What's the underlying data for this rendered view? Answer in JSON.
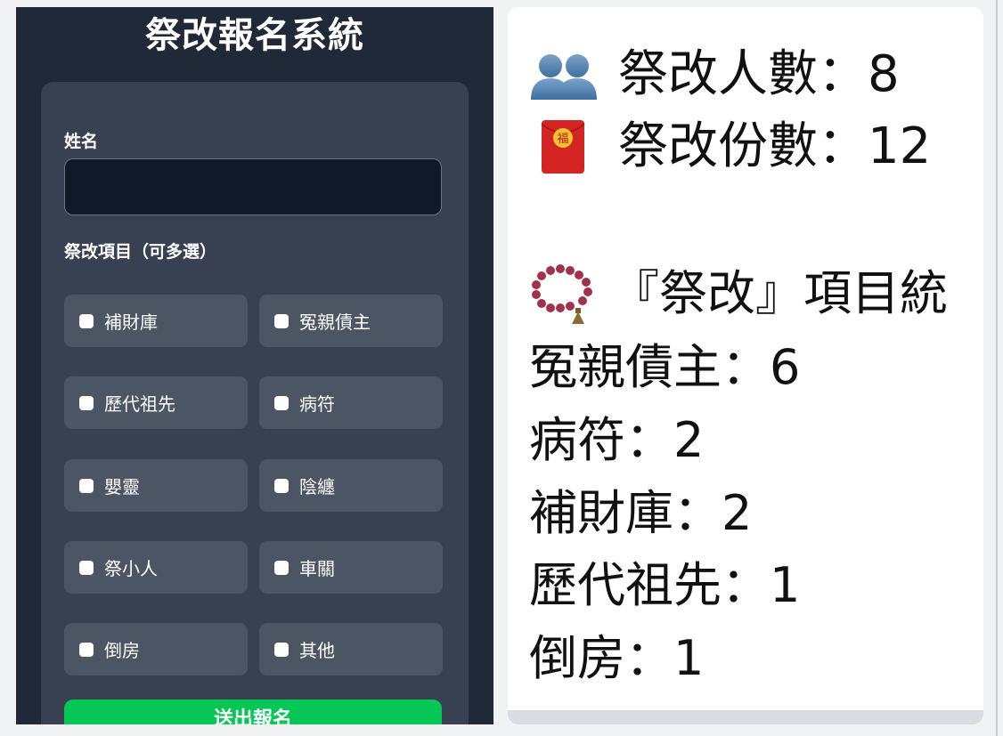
{
  "form": {
    "title": "祭改報名系統",
    "name_label": "姓名",
    "name_value": "",
    "items_label": "祭改項目（可多選）",
    "options": [
      {
        "label": "補財庫",
        "checked": false
      },
      {
        "label": "冤親債主",
        "checked": false
      },
      {
        "label": "歷代祖先",
        "checked": false
      },
      {
        "label": "病符",
        "checked": false
      },
      {
        "label": "嬰靈",
        "checked": false
      },
      {
        "label": "陰纏",
        "checked": false
      },
      {
        "label": "祭小人",
        "checked": false
      },
      {
        "label": "車關",
        "checked": false
      },
      {
        "label": "倒房",
        "checked": false
      },
      {
        "label": "其他",
        "checked": false
      }
    ],
    "submit_label": "送出報名",
    "colors": {
      "background": "#1f2937",
      "card": "#374151",
      "option": "#4b5563",
      "submit": "#06c755"
    }
  },
  "stats": {
    "people_line": "祭改人數：8",
    "copies_line": "祭改份數：12",
    "items_heading": "『祭改』項目統",
    "items": [
      "冤親債主：6",
      "病符：2",
      "補財庫：2",
      "歷代祖先：1",
      "倒房：1"
    ],
    "icons": {
      "people": "busts-in-silhouette-icon",
      "copies": "red-envelope-icon",
      "items": "prayer-beads-icon"
    },
    "envelope_char": "福"
  }
}
